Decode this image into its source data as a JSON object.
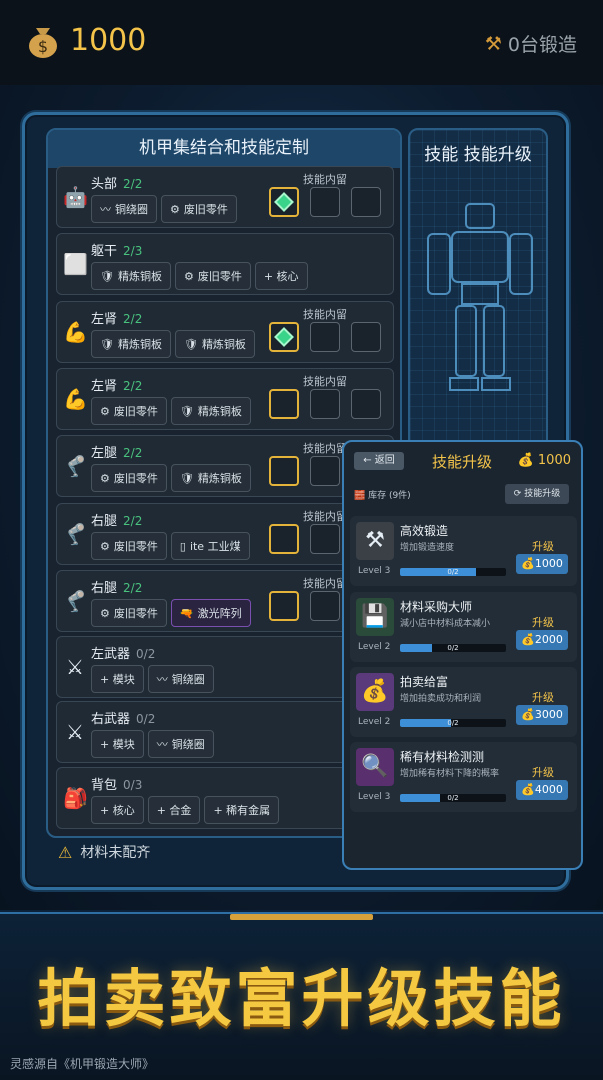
{
  "top": {
    "money": "1000",
    "forge": "0台锻造"
  },
  "left_panel": {
    "title": "机甲集结合和技能定制",
    "slot_label": "技能内留",
    "parts": [
      {
        "icon": "robot-head-icon",
        "name": "头部",
        "count": "2/2",
        "has_slots": true,
        "slot_state": "gem",
        "chips": [
          {
            "icon": "wire",
            "label": "铜绕圈"
          },
          {
            "icon": "gear",
            "label": "废旧零件"
          }
        ]
      },
      {
        "icon": "torso-icon",
        "name": "躯干",
        "count": "2/3",
        "has_slots": false,
        "chips": [
          {
            "icon": "shield",
            "label": "精炼铜板"
          },
          {
            "icon": "gear",
            "label": "废旧零件"
          },
          {
            "icon": "plus",
            "label": "+ 核心"
          }
        ]
      },
      {
        "icon": "arm-icon",
        "name": "左肾",
        "count": "2/2",
        "has_slots": true,
        "slot_state": "gem",
        "chips": [
          {
            "icon": "shield",
            "label": "精炼铜板"
          },
          {
            "icon": "shield",
            "label": "精炼铜板"
          }
        ]
      },
      {
        "icon": "arm-icon",
        "name": "左肾",
        "count": "2/2",
        "has_slots": true,
        "slot_state": "gold",
        "chips": [
          {
            "icon": "gear",
            "label": "废旧零件"
          },
          {
            "icon": "shield",
            "label": "精炼铜板"
          }
        ]
      },
      {
        "icon": "leg-icon",
        "name": "左腿",
        "count": "2/2",
        "has_slots": true,
        "slot_state": "gold",
        "chips": [
          {
            "icon": "gear",
            "label": "废旧零件"
          },
          {
            "icon": "shield",
            "label": "精炼铜板"
          }
        ]
      },
      {
        "icon": "leg-icon",
        "name": "右腿",
        "count": "2/2",
        "has_slots": true,
        "slot_state": "gold",
        "chips": [
          {
            "icon": "gear",
            "label": "废旧零件"
          },
          {
            "icon": "coal",
            "label": "ite 工业煤"
          }
        ]
      },
      {
        "icon": "leg-icon",
        "name": "右腿",
        "count": "2/2",
        "has_slots": true,
        "slot_state": "gold",
        "chips": [
          {
            "icon": "gear",
            "label": "废旧零件"
          },
          {
            "icon": "laser",
            "label": "激光阵列"
          }
        ]
      },
      {
        "icon": "swords-icon",
        "name": "左武器",
        "count": "0/2",
        "has_slots": false,
        "chips": [
          {
            "icon": "plus",
            "label": "+ 模块"
          },
          {
            "icon": "wire",
            "label": "铜绕圈"
          }
        ]
      },
      {
        "icon": "swords-icon",
        "name": "右武器",
        "count": "0/2",
        "has_slots": false,
        "chips": [
          {
            "icon": "plus",
            "label": "+ 模块"
          },
          {
            "icon": "wire",
            "label": "铜绕圈"
          }
        ]
      },
      {
        "icon": "backpack-icon",
        "name": "背包",
        "count": "0/3",
        "has_slots": false,
        "chips": [
          {
            "icon": "plus",
            "label": "+ 核心"
          },
          {
            "icon": "plus",
            "label": "+ 合金"
          },
          {
            "icon": "plus",
            "label": "+ 稀有金属"
          }
        ]
      }
    ],
    "warning": "材料未配齐"
  },
  "right_panel": {
    "title": "技能 技能升级"
  },
  "popup": {
    "back": "← 返回",
    "title": "技能升级",
    "money": "1000",
    "stock": "库存 (9件)",
    "skill_upgrade_btn": "技能升级",
    "skills": [
      {
        "name": "高效锻造",
        "desc": "增加锻造速度",
        "level": "Level 3",
        "progress_text": "0/2",
        "progress": 0.72,
        "up_label": "升级",
        "cost": "1000",
        "icon": "hammer-icon",
        "bg": "#3b4047"
      },
      {
        "name": "材料采购大师",
        "desc": "減小店中材料成本减小",
        "level": "Level 2",
        "progress_text": "0/2",
        "progress": 0.3,
        "up_label": "升级",
        "cost": "2000",
        "icon": "floppy-icon",
        "bg": "#2a4a3a"
      },
      {
        "name": "拍卖给富",
        "desc": "增加拍卖成功和利润",
        "level": "Level 2",
        "progress_text": "0/2",
        "progress": 0.48,
        "up_label": "升级",
        "cost": "3000",
        "icon": "moneybag-icon",
        "bg": "#5a3a7a"
      },
      {
        "name": "稀有材料检测测",
        "desc": "增加稀有材料下降的概率",
        "level": "Level 3",
        "progress_text": "0/2",
        "progress": 0.38,
        "up_label": "升级",
        "cost": "4000",
        "icon": "magnifier-icon",
        "bg": "#5a2f6e"
      }
    ]
  },
  "banner": {
    "slogan": "拍卖致富升级技能",
    "credit": "灵感源自《机甲锻造大师》"
  },
  "colors": {
    "gold": "#f3c34a",
    "green": "#49c27e",
    "accent_blue": "#3578b3"
  }
}
